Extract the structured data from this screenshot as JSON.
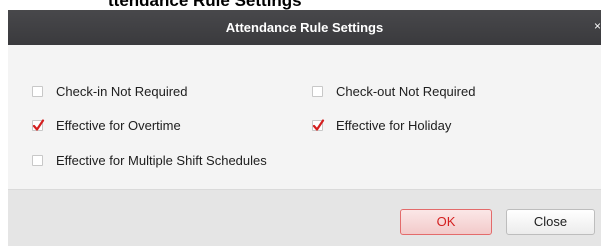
{
  "top_fragment_text": "ttendance Rule Settings",
  "dialog": {
    "title": "Attendance Rule Settings",
    "close_icon": "×"
  },
  "options": {
    "check_in_not_required": {
      "label": "Check-in Not Required",
      "checked": false
    },
    "check_out_not_required": {
      "label": "Check-out Not Required",
      "checked": false
    },
    "effective_for_overtime": {
      "label": "Effective for Overtime",
      "checked": true
    },
    "effective_for_holiday": {
      "label": "Effective for Holiday",
      "checked": true
    },
    "effective_for_multiple_shift_schedules": {
      "label": "Effective for Multiple Shift Schedules",
      "checked": false
    }
  },
  "buttons": {
    "ok": "OK",
    "close": "Close"
  },
  "colors": {
    "titlebar": "#3f3f42",
    "checkmark": "#d42020",
    "ok_text": "#d42020"
  }
}
